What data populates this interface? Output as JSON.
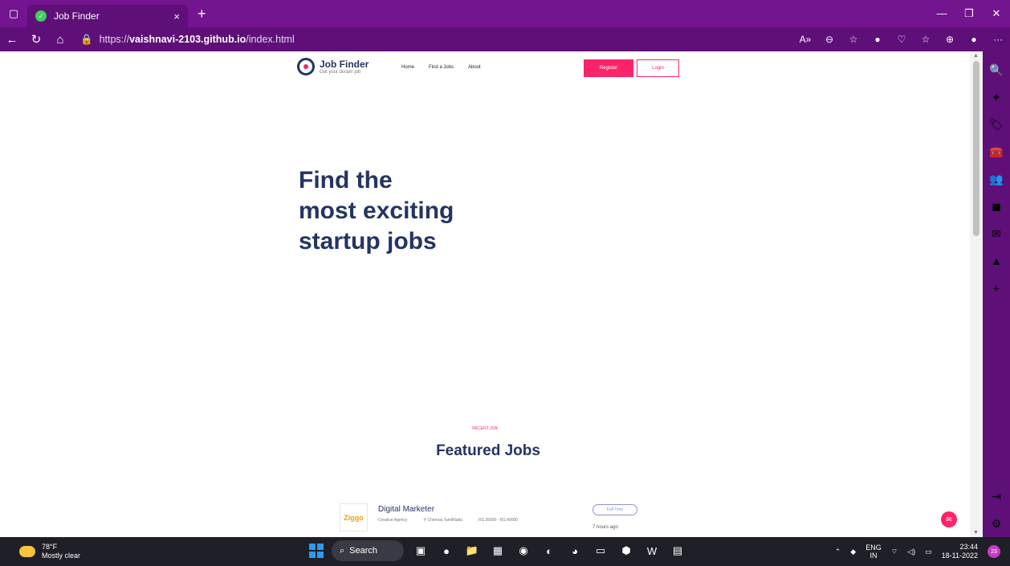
{
  "browser": {
    "tab_title": "Job Finder",
    "tab_close": "×",
    "new_tab": "+",
    "url_prefix": "https://",
    "url_host": "vaishnavi-2103.github.io",
    "url_path": "/index.html"
  },
  "site": {
    "logo_name": "Job Finder",
    "logo_tagline": "Get your doram job",
    "nav": [
      "Home",
      "Find a Jobs",
      "About"
    ],
    "register": "Register",
    "login": "Login",
    "hero_lines": [
      "Find the",
      "most exciting",
      "startup jobs"
    ],
    "recent_label": "RECENT JOB",
    "featured_title": "Featured Jobs",
    "job": {
      "company_logo": "Ziggo",
      "title": "Digital Marketer",
      "company": "Creative Agency",
      "location": "Chennai,TamilNadu",
      "salary": "RS.35000 - RS.40000",
      "type": "Full Time",
      "posted": "7 hours ago"
    }
  },
  "taskbar": {
    "temp": "78°F",
    "weather": "Mostly clear",
    "search": "Search",
    "lang_1": "ENG",
    "lang_2": "IN",
    "time": "23:44",
    "date": "18-11-2022",
    "badge": "23"
  },
  "colors": {
    "accent": "#fb246a",
    "navy": "#243463",
    "browser_frame": "#72158f"
  }
}
